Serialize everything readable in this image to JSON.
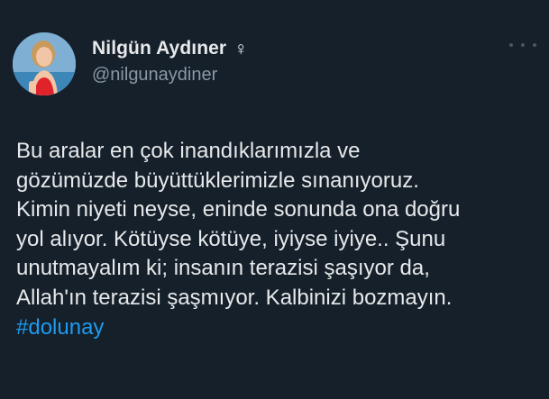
{
  "author": {
    "display_name": "Nilgün Aydıner",
    "gender_symbol": "♀",
    "handle": "@nilgunaydiner"
  },
  "tweet": {
    "lines": [
      "Bu aralar en çok inandıklarımızla ve",
      "gözümüzde büyüttüklerimizle sınanıyoruz.",
      "Kimin niyeti neyse, eninde sonunda ona doğru",
      "yol alıyor. Kötüyse kötüye, iyiyse iyiye.. Şunu",
      "unutmayalım ki; insanın terazisi şaşıyor da,",
      "Allah'ın terazisi şaşmıyor. Kalbinizi bozmayın."
    ],
    "hashtag": "#dolunay"
  },
  "icons": {
    "more": "more-horizontal-icon",
    "gender": "female-sign-icon"
  },
  "colors": {
    "background": "#15202b",
    "text": "#e7e9ea",
    "secondary_text": "#8b98a5",
    "link": "#1d9bf0"
  }
}
